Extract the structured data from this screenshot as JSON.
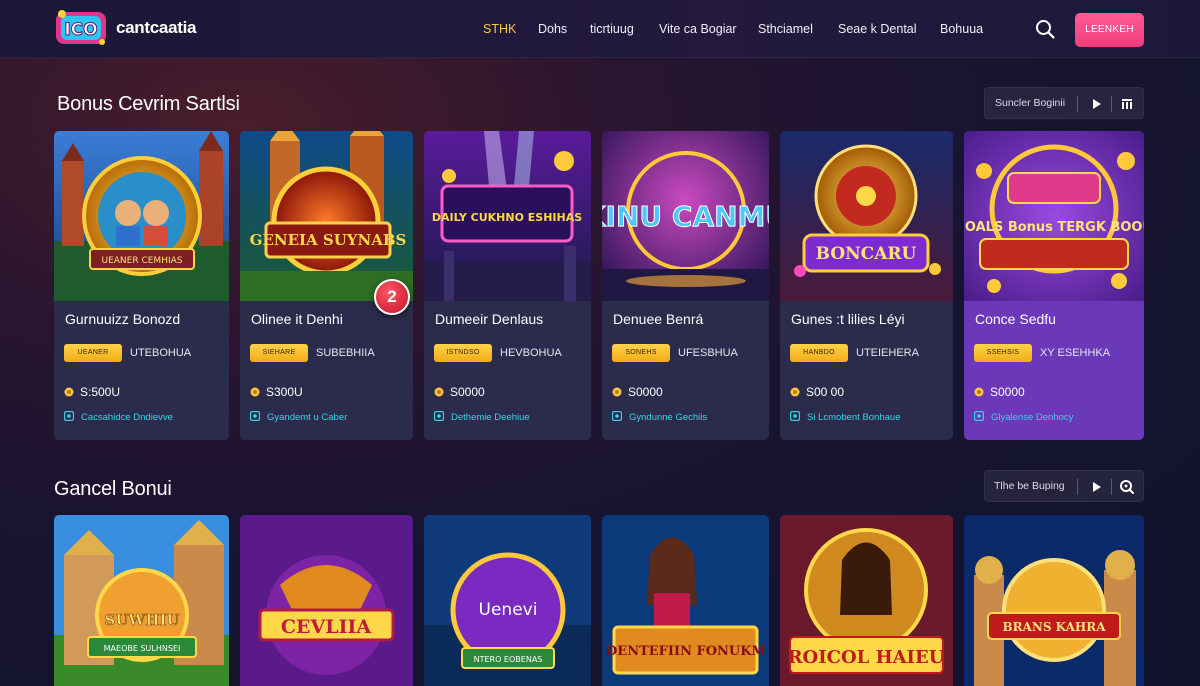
{
  "header": {
    "brand": "cantcaatia",
    "nav": [
      {
        "label": "STHK",
        "active": true
      },
      {
        "label": "Dohs",
        "active": false
      },
      {
        "label": "ticrtiuug",
        "active": false
      },
      {
        "label": "Vite ca Bogiar",
        "active": false
      },
      {
        "label": "Sthciamel",
        "active": false
      },
      {
        "label": "Seae k Dental",
        "active": false
      },
      {
        "label": "Bohuua",
        "active": false
      }
    ],
    "search_icon": "search-icon",
    "login_label": "LEENKEH"
  },
  "section1": {
    "title": "Bonus Cevrim Sartlsi",
    "control_label": "Suncler Boginii"
  },
  "cards": [
    {
      "art_label": "UEANER CEMHIAS",
      "title": "Gurnuuizz Bonozd",
      "badge": "UEANER",
      "tag": "UTEBOHUA",
      "amount": "S:500U",
      "link": "Cacsahidce Dndievve"
    },
    {
      "art_label": "GENEIA SUYNABS",
      "title": "Olinee it Denhi",
      "badge": "SIEHARE",
      "tag": "SUBEBHIIA",
      "amount": "S300U",
      "link": "Gyandemt u Caber",
      "number_badge": "2"
    },
    {
      "art_label": "DAILY CUKHNO ESHIHAS",
      "title": "Dumeeir Denlaus",
      "badge": "ISTNDSO",
      "tag": "HEVBOHUA",
      "amount": "S0000",
      "link": "Dethemie Deehiue"
    },
    {
      "art_label": "KINU CANMU",
      "title": "Denuee Benrá",
      "badge": "SONEHS",
      "tag": "UFESBHUA",
      "amount": "S0000",
      "link": "Gyndunne Gechiis"
    },
    {
      "art_label": "BONCARU",
      "title": "Gunes :t lilies Léyi",
      "badge": "HANBDO",
      "tag": "UTEIEHERA",
      "amount": "S00 00",
      "link": "Si Lcmobent Bonhaue"
    },
    {
      "art_label": "BOALS Bonus TERGK BOOU",
      "title": "Conce Sedfu",
      "badge": "SSEHSIS",
      "tag": "XY ESEHHKA",
      "amount": "S0000",
      "link": "Glyalense Denhocy"
    }
  ],
  "section2": {
    "title": "Gancel Bonui",
    "control_label": "Tlhe be Buping"
  },
  "cards2": [
    {
      "art_label": "SUWHIU",
      "sub_label": "MAEOBE SULHNSEI"
    },
    {
      "art_label": "CEVLIIA"
    },
    {
      "art_label": "Uenevi",
      "sub_label": "NTERO EOBENAS"
    },
    {
      "art_label": "DENTEFIIN FONUKM"
    },
    {
      "art_label": "ROICOL HAIEU"
    },
    {
      "art_label": "BRANS KAHRA"
    }
  ],
  "colors": {
    "accent_pink": "#f0437f",
    "accent_yellow": "#ffc83d",
    "link_cyan": "#39d4e7",
    "card_bg": "#2b2c4c",
    "card_purple": "#6a38b8"
  }
}
